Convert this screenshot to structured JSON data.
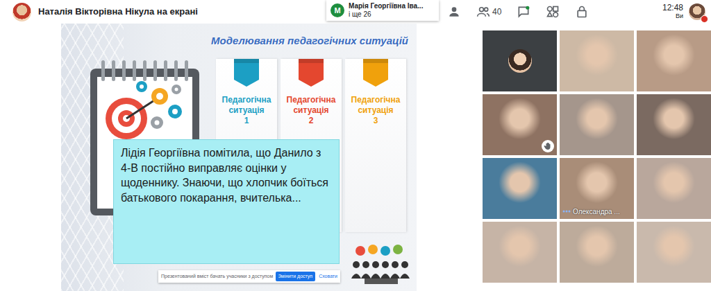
{
  "top_bar": {
    "presenter": "Наталія Вікторівна Нікула на екрані",
    "participants_count": "40",
    "time": "12:48",
    "self_label": "Ви"
  },
  "notification": {
    "initial": "M",
    "name": "Марія Георгіївна Іва...",
    "more": "і ще 26"
  },
  "slide": {
    "title": "Моделювання педагогічних ситуацій",
    "situations": [
      {
        "label": "Педагогічна ситуація",
        "number": "1",
        "color": "#1c9fc4"
      },
      {
        "label": "Педагогічна ситуація",
        "number": "2",
        "color": "#e4472f"
      },
      {
        "label": "Педагогічна ситуація",
        "number": "3",
        "color": "#f0a10c"
      }
    ],
    "card_text": "Лідія Георгіївна помітила, що Данило з 4-В постійно виправляє оцінки у щоденнику. Знаючи, що хлопчик боїться батькового покарання, вчителька...",
    "share_bar": {
      "text": "Презентований вміст бачать учасники з доступом",
      "buttons": [
        "Змінити доступ",
        "Сховати"
      ]
    }
  },
  "tiles": [
    {
      "kind": "avatar",
      "name": "",
      "hand_raised": false,
      "talking": false
    },
    {
      "kind": "video",
      "name": "",
      "hand_raised": false,
      "talking": false
    },
    {
      "kind": "video",
      "name": "",
      "hand_raised": false,
      "talking": false
    },
    {
      "kind": "video",
      "name": "",
      "hand_raised": true,
      "talking": false
    },
    {
      "kind": "video",
      "name": "",
      "hand_raised": false,
      "talking": false
    },
    {
      "kind": "video",
      "name": "",
      "hand_raised": false,
      "talking": false
    },
    {
      "kind": "video",
      "name": "",
      "hand_raised": false,
      "talking": false
    },
    {
      "kind": "video",
      "name": "Олександра ...",
      "hand_raised": false,
      "talking": true
    },
    {
      "kind": "video",
      "name": "",
      "hand_raised": false,
      "talking": false
    },
    {
      "kind": "video",
      "name": "",
      "hand_raised": false,
      "talking": false
    },
    {
      "kind": "video",
      "name": "",
      "hand_raised": false,
      "talking": false
    },
    {
      "kind": "video",
      "name": "",
      "hand_raised": false,
      "talking": false
    }
  ]
}
